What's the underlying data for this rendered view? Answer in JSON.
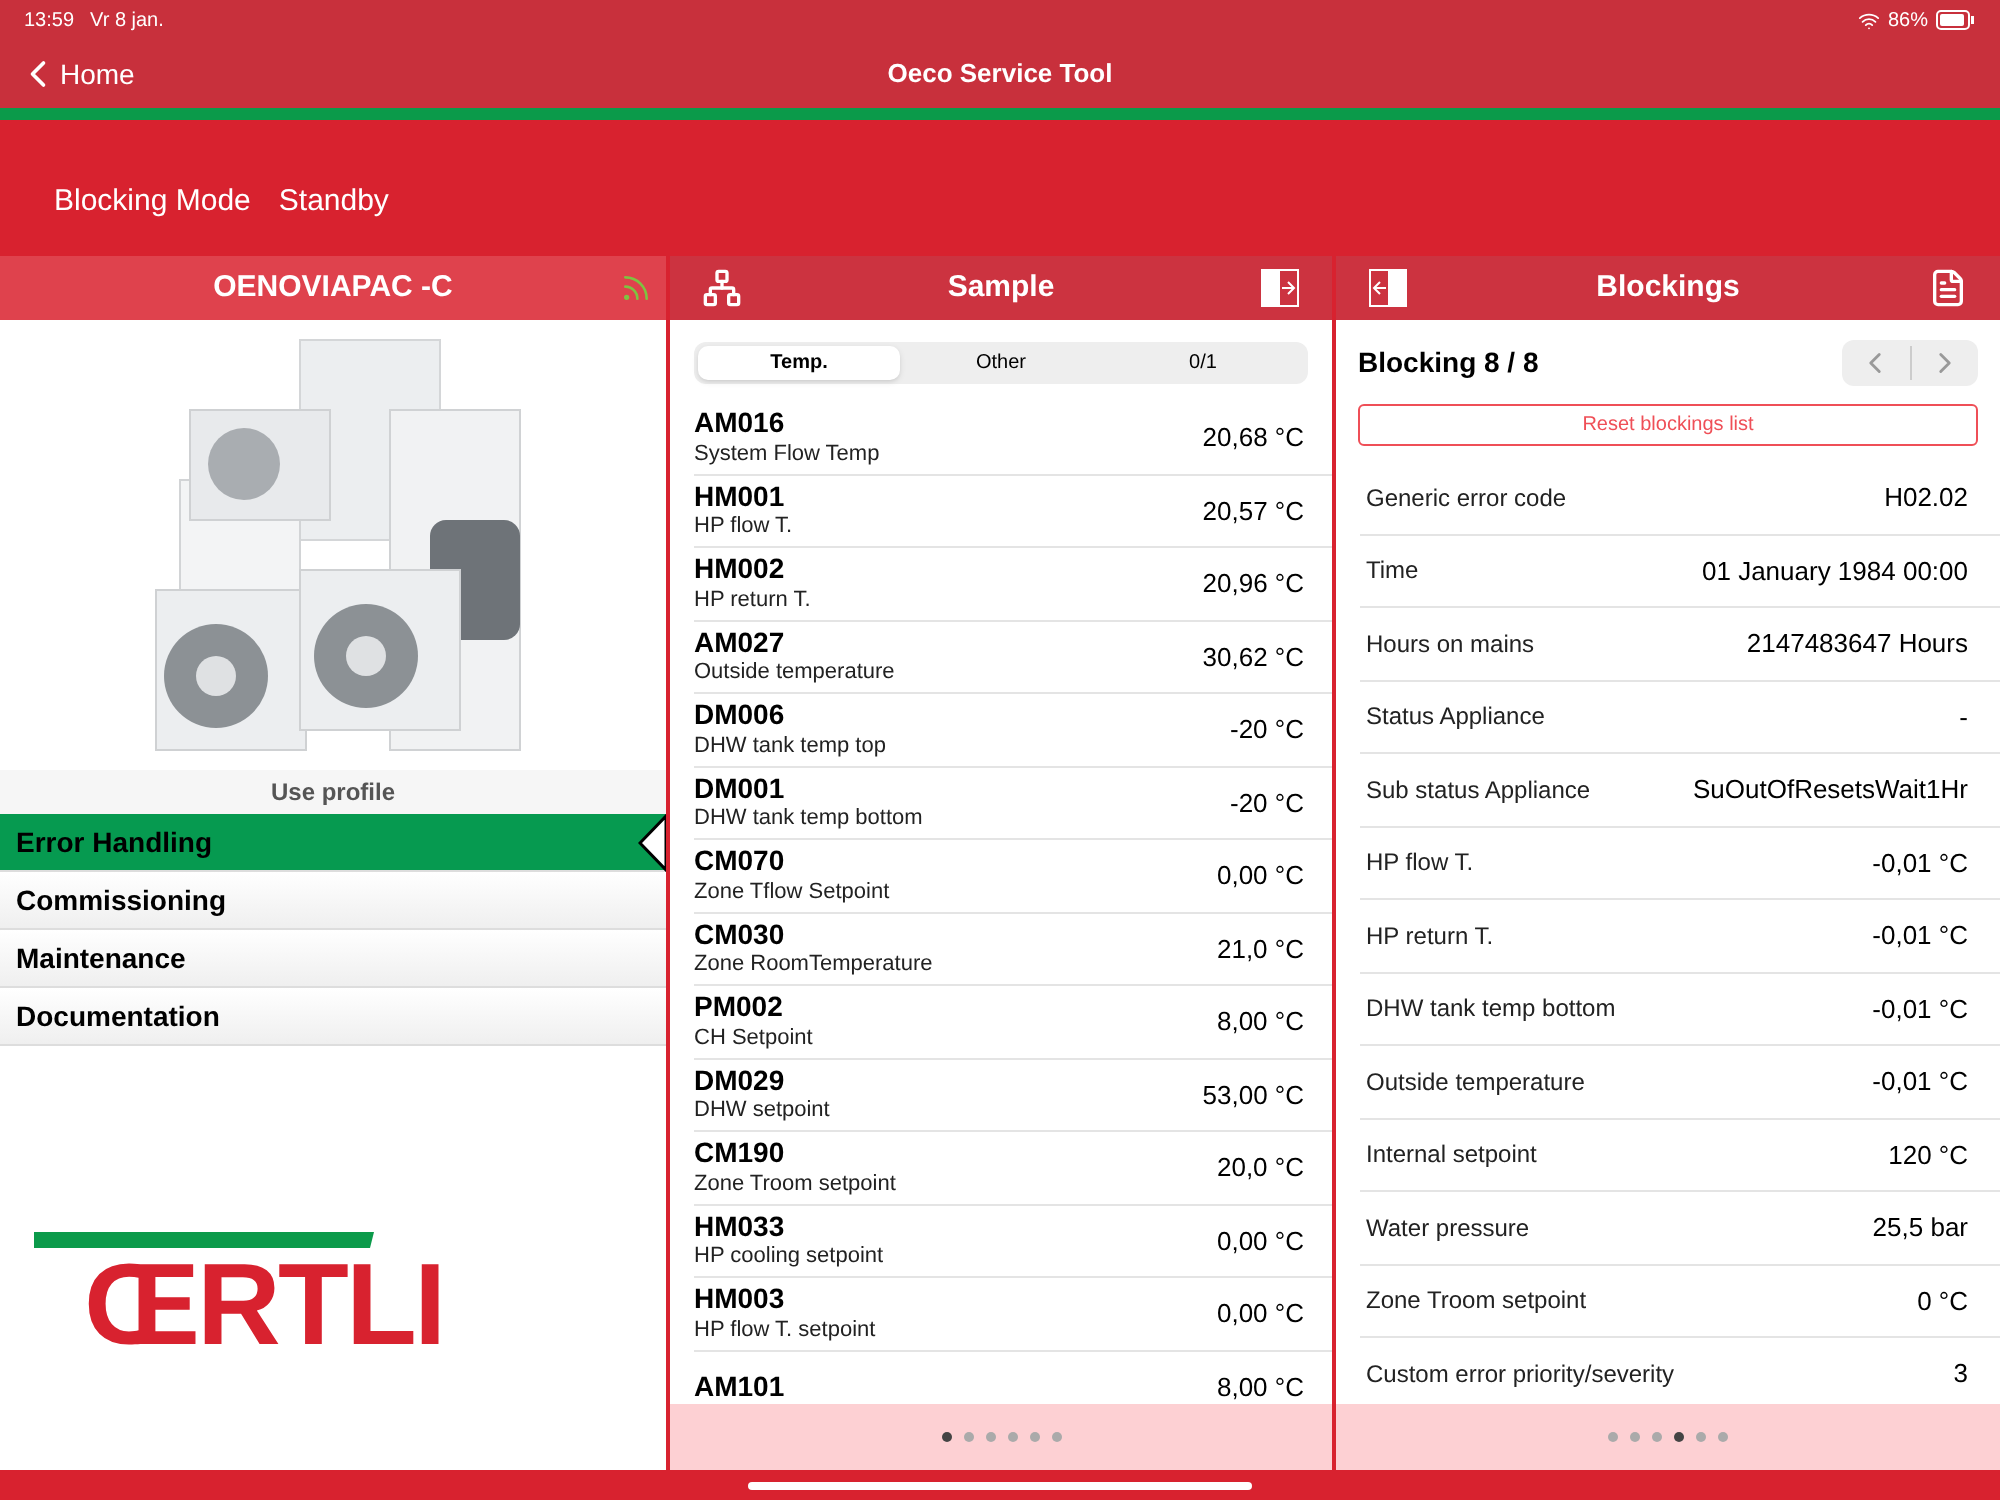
{
  "status_bar": {
    "time": "13:59",
    "date": "Vr 8 jan.",
    "battery": "86%"
  },
  "nav": {
    "back": "Home",
    "title": "Oeco Service Tool"
  },
  "mode": {
    "label": "Blocking Mode",
    "value": "Standby"
  },
  "left": {
    "title": "OENOVIAPAC -C",
    "profile_label": "Use profile",
    "menu": [
      {
        "label": "Error Handling",
        "selected": true
      },
      {
        "label": "Commissioning",
        "selected": false
      },
      {
        "label": "Maintenance",
        "selected": false
      },
      {
        "label": "Documentation",
        "selected": false
      }
    ],
    "logo": "ŒRTLI"
  },
  "sample": {
    "title": "Sample",
    "segments": [
      {
        "label": "Temp.",
        "selected": true
      },
      {
        "label": "Other",
        "selected": false
      },
      {
        "label": "0/1",
        "selected": false
      }
    ],
    "rows": [
      {
        "code": "AM016",
        "name": "System Flow Temp",
        "value": "20,68 °C"
      },
      {
        "code": "HM001",
        "name": "HP flow T.",
        "value": "20,57 °C"
      },
      {
        "code": "HM002",
        "name": "HP return T.",
        "value": "20,96 °C"
      },
      {
        "code": "AM027",
        "name": "Outside temperature",
        "value": "30,62 °C"
      },
      {
        "code": "DM006",
        "name": "DHW tank temp top",
        "value": "-20 °C"
      },
      {
        "code": "DM001",
        "name": "DHW tank temp bottom",
        "value": "-20 °C"
      },
      {
        "code": "CM070",
        "name": "Zone Tflow Setpoint",
        "value": "0,00 °C"
      },
      {
        "code": "CM030",
        "name": "Zone RoomTemperature",
        "value": "21,0 °C"
      },
      {
        "code": "PM002",
        "name": "CH Setpoint",
        "value": "8,00 °C"
      },
      {
        "code": "DM029",
        "name": "DHW setpoint",
        "value": "53,00 °C"
      },
      {
        "code": "CM190",
        "name": "Zone Troom setpoint",
        "value": "20,0 °C"
      },
      {
        "code": "HM033",
        "name": "HP cooling setpoint",
        "value": "0,00 °C"
      },
      {
        "code": "HM003",
        "name": "HP flow T. setpoint",
        "value": "0,00 °C"
      },
      {
        "code": "AM101",
        "value": "8,00 °C"
      }
    ],
    "pages": [
      {
        "selected": true
      },
      {
        "selected": false
      },
      {
        "selected": false
      },
      {
        "selected": false
      },
      {
        "selected": false
      },
      {
        "selected": false
      }
    ]
  },
  "blockings": {
    "title": "Blockings",
    "heading": "Blocking 8 / 8",
    "reset": "Reset blockings list",
    "rows": [
      {
        "label": "Generic error code",
        "value": "H02.02"
      },
      {
        "label": "Time",
        "value": "01 January 1984 00:00"
      },
      {
        "label": "Hours on mains",
        "value": "2147483647 Hours"
      },
      {
        "label": "Status Appliance",
        "value": "-"
      },
      {
        "label": "Sub status Appliance",
        "value": "SuOutOfResetsWait1Hr"
      },
      {
        "label": "HP flow T.",
        "value": "-0,01 °C"
      },
      {
        "label": "HP return T.",
        "value": "-0,01 °C"
      },
      {
        "label": "DHW tank temp bottom",
        "value": "-0,01 °C"
      },
      {
        "label": "Outside temperature",
        "value": "-0,01 °C"
      },
      {
        "label": "Internal setpoint",
        "value": "120 °C"
      },
      {
        "label": "Water pressure",
        "value": "25,5 bar"
      },
      {
        "label": "Zone Troom setpoint",
        "value": "0 °C"
      },
      {
        "label": "Custom error priority/severity",
        "value": "3"
      }
    ],
    "pages": [
      {
        "selected": false
      },
      {
        "selected": false
      },
      {
        "selected": false
      },
      {
        "selected": true
      },
      {
        "selected": false
      },
      {
        "selected": false
      }
    ]
  }
}
